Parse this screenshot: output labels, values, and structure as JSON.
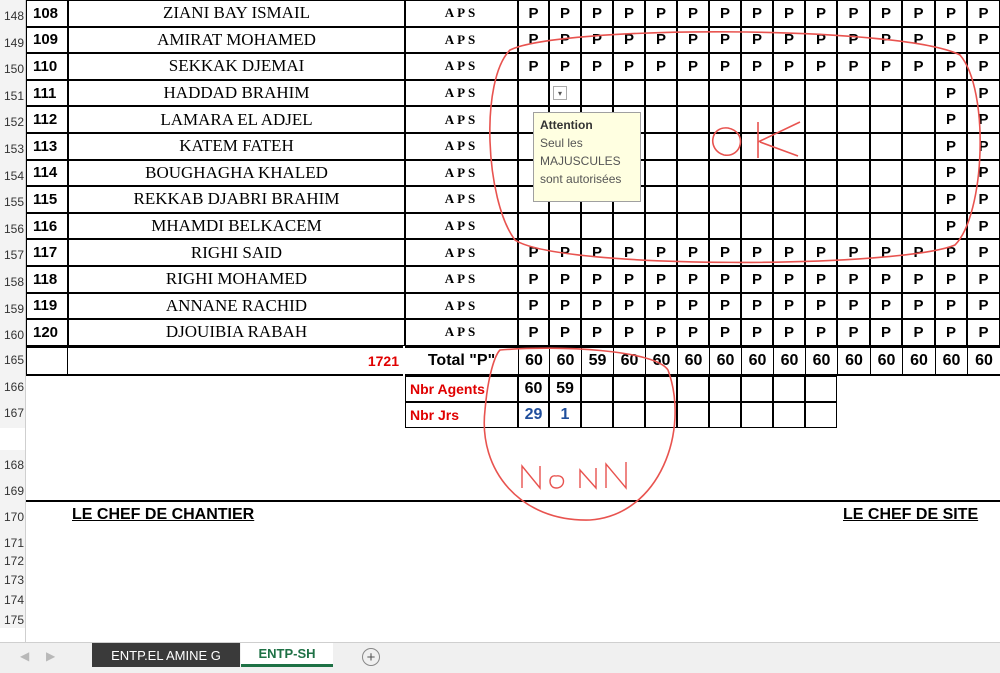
{
  "rows": [
    {
      "rownum": "148",
      "id": "108",
      "name": "ZIANI BAY  ISMAIL",
      "code": "APS",
      "marks": [
        "P",
        "P",
        "P",
        "P",
        "P",
        "P",
        "P",
        "P",
        "P",
        "P",
        "P",
        "P",
        "P",
        "P",
        "P"
      ]
    },
    {
      "rownum": "149",
      "id": "109",
      "name": "AMIRAT MOHAMED",
      "code": "APS",
      "marks": [
        "P",
        "P",
        "P",
        "P",
        "P",
        "P",
        "P",
        "P",
        "P",
        "P",
        "P",
        "P",
        "P",
        "P",
        "P"
      ]
    },
    {
      "rownum": "150",
      "id": "110",
      "name": "SEKKAK  DJEMAI",
      "code": "APS",
      "marks": [
        "P",
        "P",
        "P",
        "P",
        "P",
        "P",
        "P",
        "P",
        "P",
        "P",
        "P",
        "P",
        "P",
        "P",
        "P"
      ]
    },
    {
      "rownum": "151",
      "id": "111",
      "name": "HADDAD  BRAHIM",
      "code": "APS",
      "marks": [
        "",
        "",
        "",
        "",
        "",
        "",
        "",
        "",
        "",
        "",
        "",
        "",
        "",
        "P",
        "P"
      ]
    },
    {
      "rownum": "152",
      "id": "112",
      "name": "LAMARA EL ADJEL",
      "code": "APS",
      "marks": [
        "",
        "",
        "",
        "",
        "",
        "",
        "",
        "",
        "",
        "",
        "",
        "",
        "",
        "P",
        "P"
      ]
    },
    {
      "rownum": "153",
      "id": "113",
      "name": "KATEM FATEH",
      "code": "APS",
      "marks": [
        "",
        "",
        "",
        "",
        "",
        "",
        "",
        "",
        "",
        "",
        "",
        "",
        "",
        "P",
        "P"
      ]
    },
    {
      "rownum": "154",
      "id": "114",
      "name": "BOUGHAGHA  KHALED",
      "code": "APS",
      "marks": [
        "",
        "",
        "",
        "",
        "",
        "",
        "",
        "",
        "",
        "",
        "",
        "",
        "",
        "P",
        "P"
      ]
    },
    {
      "rownum": "155",
      "id": "115",
      "name": "REKKAB DJABRI BRAHIM",
      "code": "APS",
      "marks": [
        "",
        "",
        "",
        "",
        "",
        "",
        "",
        "",
        "",
        "",
        "",
        "",
        "",
        "P",
        "P"
      ]
    },
    {
      "rownum": "156",
      "id": "116",
      "name": "MHAMDI BELKACEM",
      "code": "APS",
      "marks": [
        "",
        "",
        "",
        "",
        "",
        "",
        "",
        "",
        "",
        "",
        "",
        "",
        "",
        "P",
        "P"
      ]
    },
    {
      "rownum": "157",
      "id": "117",
      "name": "RIGHI  SAID",
      "code": "APS",
      "marks": [
        "P",
        "P",
        "P",
        "P",
        "P",
        "P",
        "P",
        "P",
        "P",
        "P",
        "P",
        "P",
        "P",
        "P",
        "P"
      ]
    },
    {
      "rownum": "158",
      "id": "118",
      "name": "RIGHI MOHAMED",
      "code": "APS",
      "marks": [
        "P",
        "P",
        "P",
        "P",
        "P",
        "P",
        "P",
        "P",
        "P",
        "P",
        "P",
        "P",
        "P",
        "P",
        "P"
      ]
    },
    {
      "rownum": "159",
      "id": "119",
      "name": "ANNANE RACHID",
      "code": "APS",
      "marks": [
        "P",
        "P",
        "P",
        "P",
        "P",
        "P",
        "P",
        "P",
        "P",
        "P",
        "P",
        "P",
        "P",
        "P",
        "P"
      ]
    },
    {
      "rownum": "160",
      "id": "120",
      "name": "DJOUIBIA  RABAH",
      "code": "APS",
      "marks": [
        "P",
        "P",
        "P",
        "P",
        "P",
        "P",
        "P",
        "P",
        "P",
        "P",
        "P",
        "P",
        "P",
        "P",
        "P"
      ]
    }
  ],
  "total_row": {
    "rownum": "165",
    "count": "1721",
    "label": "Total \"P\"",
    "values": [
      "60",
      "60",
      "59",
      "60",
      "60",
      "60",
      "60",
      "60",
      "60",
      "60",
      "60",
      "60",
      "60",
      "60",
      "60"
    ]
  },
  "agents_row": {
    "rownum": "166",
    "label": "Nbr  Agents",
    "values": [
      "60",
      "59"
    ]
  },
  "jrs_row": {
    "rownum": "167",
    "label": "Nbr Jrs",
    "values": [
      "29",
      "1"
    ]
  },
  "empty_rows": [
    "168",
    "169",
    "171",
    "172",
    "173",
    "174",
    "175"
  ],
  "sign_row": {
    "rownum": "170",
    "left": "LE CHEF DE CHANTIER",
    "right": "LE CHEF DE SITE"
  },
  "tooltip": {
    "title": "Attention",
    "line1": "Seul les",
    "line2": "MAJUSCULES",
    "line3": "sont autorisées"
  },
  "annotations": {
    "ok": "OK",
    "non": "NON",
    "color": "#e8534f"
  },
  "sheet_tabs": [
    {
      "label": "ENTP.EL AMINE G",
      "active": false
    },
    {
      "label": "ENTP-SH",
      "active": true
    }
  ],
  "add_sheet": "+",
  "colors": {
    "red_label": "#e00000",
    "blue_value": "#1f4e9c",
    "active_tab": "#1e7145",
    "tab_dark": "#3a3a3a"
  }
}
